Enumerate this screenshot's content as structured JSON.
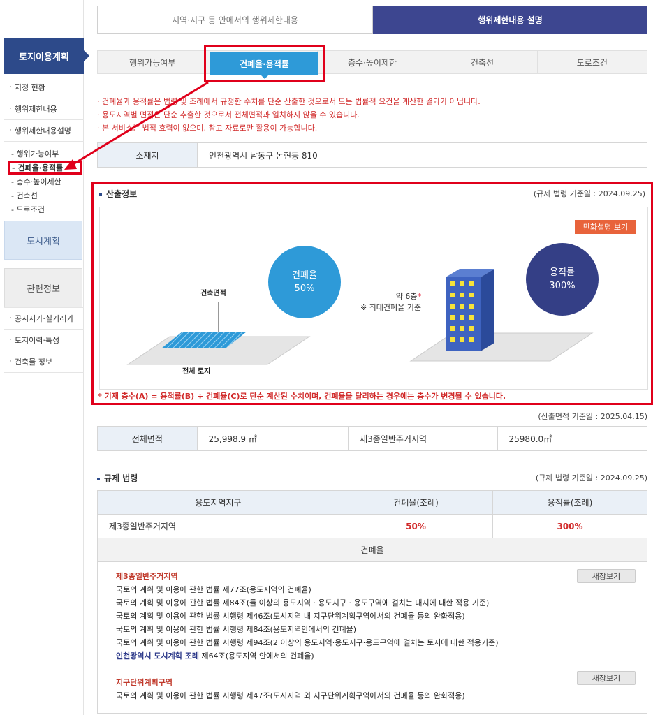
{
  "sidebar": {
    "header": "토지이용계획",
    "menu": [
      "지정 현황",
      "행위제한내용",
      "행위제한내용설명"
    ],
    "submenu": [
      "- 행위가능여부",
      "- 건폐율·용적률",
      "- 층수·높이제한",
      "- 건축선",
      "- 도로조건"
    ],
    "city_plan": "도시계획",
    "related_info": "관련정보",
    "related_menu": [
      "공시지가·실거래가",
      "토지이력·특성",
      "건축물 정보"
    ]
  },
  "top_tabs": [
    "지역·지구 등 안에서의 행위제한내용",
    "행위제한내용 설명"
  ],
  "sub_tabs": [
    "행위가능여부",
    "건폐율·용적률",
    "층수·높이제한",
    "건축선",
    "도로조건"
  ],
  "notices": [
    "· 건폐율과 용적률은 법령 및 조례에서 규정한 수치를 단순 산출한 것으로서 모든 법률적 요건을 계산한 결과가 아닙니다.",
    "· 용도지역별 면적은 단순 추출한 것으로서 전체면적과 일치하지 않을 수 있습니다.",
    "· 본 서비스는 법적 효력이 없으며, 참고 자료로만 활용이 가능합니다."
  ],
  "address": {
    "label": "소재지",
    "value": "인천광역시 남동구 논현동 810"
  },
  "calc": {
    "title": "산출정보",
    "date": "(규제 법령 기준일 : 2024.09.25)",
    "cartoon_button": "만화설명 보기",
    "bcr_label": "건폐율",
    "bcr_value": "50%",
    "far_label": "용적률",
    "far_value": "300%",
    "building_area": "건축면적",
    "total_land": "전체 토지",
    "floors_note": "약 6층",
    "floors_star": "*",
    "floors_basis": "※ 최대건폐율 기준",
    "footnote": "* 기재 층수(A) = 용적률(B) ÷ 건폐율(C)로 단순 계산된 수치이며, 건폐율을 달리하는 경우에는 층수가 변경될 수 있습니다."
  },
  "area": {
    "date": "(산출면적 기준일 : 2025.04.15)",
    "total_label": "전체면적",
    "total_value": "25,998.9 ㎡",
    "zone_label": "제3종일반주거지역",
    "zone_value": "25980.0㎡"
  },
  "regulation": {
    "title": "규제 법령",
    "date": "(규제 법령 기준일 : 2024.09.25)",
    "headers": [
      "용도지역지구",
      "건폐율(조례)",
      "용적률(조례)"
    ],
    "row": [
      "제3종일반주거지역",
      "50%",
      "300%"
    ],
    "sub_header": "건폐율",
    "view_button": "새창보기",
    "group1_title": "제3종일반주거지역",
    "group1_lines": [
      "국토의 계획 및 이용에 관한 법률 제77조(용도지역의 건폐율)",
      "국토의 계획 및 이용에 관한 법률 제84조(둘 이상의 용도지역 · 용도지구 · 용도구역에 걸치는 대지에 대한 적용 기준)",
      "국토의 계획 및 이용에 관한 법률 시행령 제46조(도시지역 내 지구단위계획구역에서의 건폐율 등의 완화적용)",
      "국토의 계획 및 이용에 관한 법률 시행령 제84조(용도지역안에서의 건폐율)",
      "국토의 계획 및 이용에 관한 법률 시행령 제94조(2 이상의 용도지역·용도지구·용도구역에 걸치는 토지에 대한 적용기준)"
    ],
    "group1_link": "인천광역시 도시계획 조례",
    "group1_link_rest": " 제64조(용도지역 안에서의 건폐율)",
    "group2_title": "지구단위계획구역",
    "group2_lines": [
      "국토의 계획 및 이용에 관한 법률 시행령 제47조(도시지역 외 지구단위계획구역에서의 건폐율 등의 완화적용)"
    ]
  }
}
